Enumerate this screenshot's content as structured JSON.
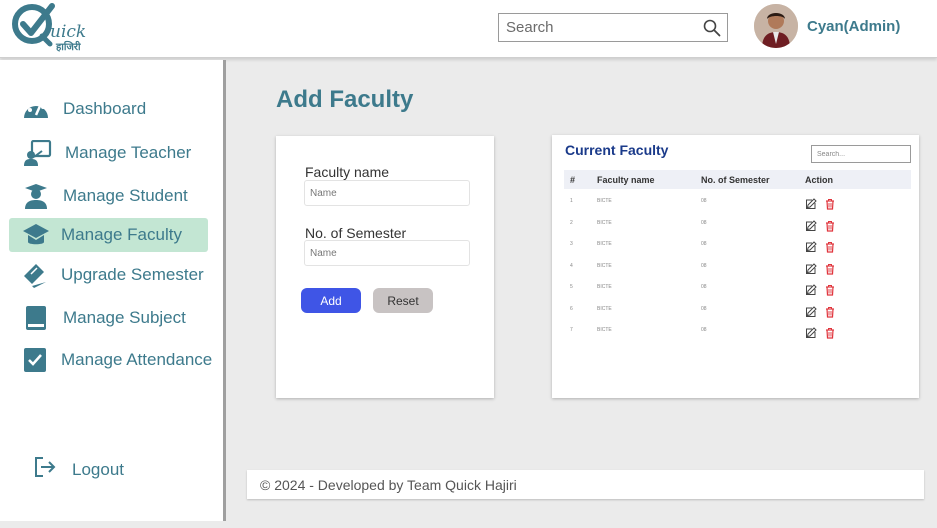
{
  "header": {
    "logo_text": "uick",
    "logo_sub": "हाजिरी",
    "search_placeholder": "Search",
    "user_name": "Cyan(Admin)"
  },
  "sidebar": {
    "items": [
      {
        "label": "Dashboard",
        "icon": "dashboard-icon"
      },
      {
        "label": "Manage Teacher",
        "icon": "teacher-icon"
      },
      {
        "label": "Manage Student",
        "icon": "student-icon"
      },
      {
        "label": "Manage Faculty",
        "icon": "faculty-icon",
        "active": true
      },
      {
        "label": "Upgrade Semester",
        "icon": "semester-icon"
      },
      {
        "label": "Manage Subject",
        "icon": "subject-icon"
      },
      {
        "label": "Manage Attendance",
        "icon": "attendance-icon"
      }
    ],
    "logout_label": "Logout"
  },
  "main": {
    "title": "Add Faculty",
    "form": {
      "faculty_label": "Faculty name",
      "faculty_placeholder": "Name",
      "semester_label": "No. of Semester",
      "semester_placeholder": "Name",
      "add_label": "Add",
      "reset_label": "Reset"
    },
    "table": {
      "title": "Current Faculty",
      "search_placeholder": "Search...",
      "columns": [
        "#",
        "Faculty name",
        "No. of Semester",
        "Action"
      ],
      "rows": [
        {
          "num": "1",
          "name": "BICTE",
          "semesters": "08"
        },
        {
          "num": "2",
          "name": "BICTE",
          "semesters": "08"
        },
        {
          "num": "3",
          "name": "BICTE",
          "semesters": "08"
        },
        {
          "num": "4",
          "name": "BICTE",
          "semesters": "08"
        },
        {
          "num": "5",
          "name": "BICTE",
          "semesters": "08"
        },
        {
          "num": "6",
          "name": "BICTE",
          "semesters": "08"
        },
        {
          "num": "7",
          "name": "BICTE",
          "semesters": "08"
        }
      ]
    }
  },
  "footer": {
    "text": "© 2024 - Developed by Team Quick Hajiri"
  },
  "colors": {
    "accent": "#3d7a8c",
    "active_bg": "#c3e6d3",
    "add_button": "#3f55e6",
    "reset_button": "#c8c3c3",
    "delete_icon": "#e0343c",
    "table_title": "#1a3a8a"
  }
}
